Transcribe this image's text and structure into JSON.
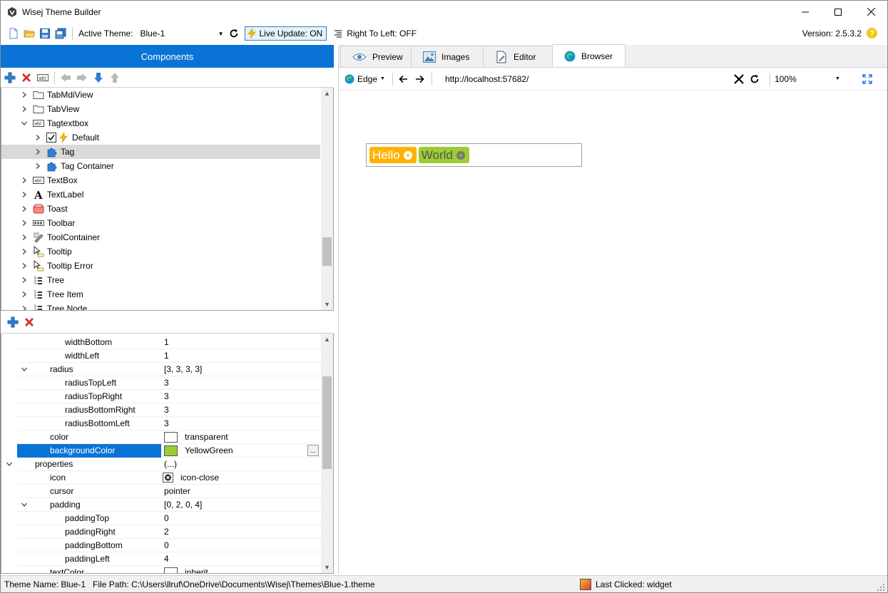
{
  "window": {
    "title": "Wisej Theme Builder",
    "controls": [
      "minimize-icon",
      "maximize-icon",
      "close-icon"
    ]
  },
  "toolbar": {
    "active_theme_label": "Active Theme:",
    "active_theme_value": "Blue-1",
    "live_update": "Live Update: ON",
    "rtl": "Right To Left: OFF",
    "version": "Version: 2.5.3.2",
    "help": "?"
  },
  "components": {
    "header": "Components",
    "tree": [
      {
        "label": "TabMdiView",
        "level": 0,
        "icon": "folder-icon"
      },
      {
        "label": "TabView",
        "level": 0,
        "icon": "folder-icon"
      },
      {
        "label": "Tagtextbox",
        "level": 0,
        "icon": "textbox-icon",
        "expanded": true
      },
      {
        "label": "Default",
        "level": 1,
        "icon": "bolt-icon",
        "checked": true
      },
      {
        "label": "Tag",
        "level": 1,
        "icon": "puzzle-icon",
        "selected": true
      },
      {
        "label": "Tag Container",
        "level": 1,
        "icon": "puzzle-icon"
      },
      {
        "label": "TextBox",
        "level": 0,
        "icon": "textbox-icon"
      },
      {
        "label": "TextLabel",
        "level": 0,
        "icon": "text-a-icon"
      },
      {
        "label": "Toast",
        "level": 0,
        "icon": "toast-icon"
      },
      {
        "label": "Toolbar",
        "level": 0,
        "icon": "toolbar-icon"
      },
      {
        "label": "ToolContainer",
        "level": 0,
        "icon": "tool-icon"
      },
      {
        "label": "Tooltip",
        "level": 0,
        "icon": "tooltip-icon"
      },
      {
        "label": "Tooltip Error",
        "level": 0,
        "icon": "tooltip-icon"
      },
      {
        "label": "Tree",
        "level": 0,
        "icon": "tree-icon"
      },
      {
        "label": "Tree Item",
        "level": 0,
        "icon": "tree-icon"
      },
      {
        "label": "Tree Node",
        "level": 0,
        "icon": "tree-icon"
      }
    ]
  },
  "properties": [
    {
      "name": "widthBottom",
      "value": "1",
      "indent": 2
    },
    {
      "name": "widthLeft",
      "value": "1",
      "indent": 2
    },
    {
      "name": "radius",
      "value": "[3, 3, 3, 3]",
      "indent": 1,
      "expanded": true
    },
    {
      "name": "radiusTopLeft",
      "value": "3",
      "indent": 2
    },
    {
      "name": "radiusTopRight",
      "value": "3",
      "indent": 2
    },
    {
      "name": "radiusBottomRight",
      "value": "3",
      "indent": 2
    },
    {
      "name": "radiusBottomLeft",
      "value": "3",
      "indent": 2
    },
    {
      "name": "color",
      "value": "transparent",
      "indent": 1,
      "swatch": "#ffffff"
    },
    {
      "name": "backgroundColor",
      "value": "YellowGreen",
      "indent": 1,
      "swatch": "#9acd32",
      "selected": true
    },
    {
      "name": "properties",
      "value": "(...)",
      "indent": 0,
      "expanded": true
    },
    {
      "name": "icon",
      "value": "icon-close",
      "indent": 1,
      "icon": "close-circle-icon"
    },
    {
      "name": "cursor",
      "value": "pointer",
      "indent": 1
    },
    {
      "name": "padding",
      "value": "[0, 2, 0, 4]",
      "indent": 1,
      "expanded": true
    },
    {
      "name": "paddingTop",
      "value": "0",
      "indent": 2
    },
    {
      "name": "paddingRight",
      "value": "2",
      "indent": 2
    },
    {
      "name": "paddingBottom",
      "value": "0",
      "indent": 2
    },
    {
      "name": "paddingLeft",
      "value": "4",
      "indent": 2
    },
    {
      "name": "textColor",
      "value": "inherit",
      "indent": 1,
      "swatch": "#ffffff"
    }
  ],
  "tabs": [
    {
      "label": "Preview",
      "icon": "eye-icon"
    },
    {
      "label": "Images",
      "icon": "image-icon"
    },
    {
      "label": "Editor",
      "icon": "editor-icon"
    },
    {
      "label": "Browser",
      "icon": "edge-icon",
      "active": true
    }
  ],
  "browser": {
    "engine": "Edge",
    "url": "http://localhost:57682/",
    "zoom": "100%"
  },
  "preview": {
    "tags": [
      {
        "text": "Hello",
        "bg": "#ffb300",
        "fg": "#ffffff",
        "x_bg": "#ffffff",
        "x_fg": "#ffb300"
      },
      {
        "text": "World",
        "bg": "#9acd32",
        "fg": "#555555",
        "x_bg": "#777777",
        "x_fg": "#9acd32"
      }
    ]
  },
  "status": {
    "theme_name": "Theme Name: Blue-1",
    "file_path": "File Path: C:\\Users\\llruf\\OneDrive\\Documents\\Wisej\\Themes\\Blue-1.theme",
    "last_clicked": "Last Clicked: widget"
  },
  "colors": {
    "accent": "#0a74d6",
    "selection": "#d9d9d9"
  }
}
